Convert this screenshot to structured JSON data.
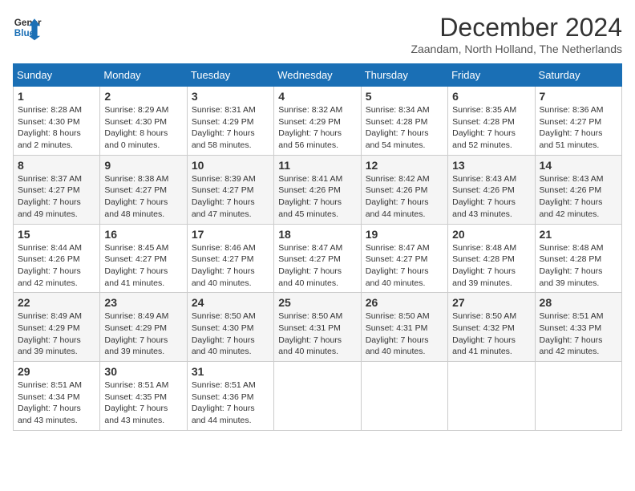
{
  "logo": {
    "line1": "General",
    "line2": "Blue"
  },
  "title": "December 2024",
  "subtitle": "Zaandam, North Holland, The Netherlands",
  "days_of_week": [
    "Sunday",
    "Monday",
    "Tuesday",
    "Wednesday",
    "Thursday",
    "Friday",
    "Saturday"
  ],
  "weeks": [
    [
      {
        "day": "1",
        "sunrise": "8:28 AM",
        "sunset": "4:30 PM",
        "daylight": "8 hours and 2 minutes."
      },
      {
        "day": "2",
        "sunrise": "8:29 AM",
        "sunset": "4:30 PM",
        "daylight": "8 hours and 0 minutes."
      },
      {
        "day": "3",
        "sunrise": "8:31 AM",
        "sunset": "4:29 PM",
        "daylight": "7 hours and 58 minutes."
      },
      {
        "day": "4",
        "sunrise": "8:32 AM",
        "sunset": "4:29 PM",
        "daylight": "7 hours and 56 minutes."
      },
      {
        "day": "5",
        "sunrise": "8:34 AM",
        "sunset": "4:28 PM",
        "daylight": "7 hours and 54 minutes."
      },
      {
        "day": "6",
        "sunrise": "8:35 AM",
        "sunset": "4:28 PM",
        "daylight": "7 hours and 52 minutes."
      },
      {
        "day": "7",
        "sunrise": "8:36 AM",
        "sunset": "4:27 PM",
        "daylight": "7 hours and 51 minutes."
      }
    ],
    [
      {
        "day": "8",
        "sunrise": "8:37 AM",
        "sunset": "4:27 PM",
        "daylight": "7 hours and 49 minutes."
      },
      {
        "day": "9",
        "sunrise": "8:38 AM",
        "sunset": "4:27 PM",
        "daylight": "7 hours and 48 minutes."
      },
      {
        "day": "10",
        "sunrise": "8:39 AM",
        "sunset": "4:27 PM",
        "daylight": "7 hours and 47 minutes."
      },
      {
        "day": "11",
        "sunrise": "8:41 AM",
        "sunset": "4:26 PM",
        "daylight": "7 hours and 45 minutes."
      },
      {
        "day": "12",
        "sunrise": "8:42 AM",
        "sunset": "4:26 PM",
        "daylight": "7 hours and 44 minutes."
      },
      {
        "day": "13",
        "sunrise": "8:43 AM",
        "sunset": "4:26 PM",
        "daylight": "7 hours and 43 minutes."
      },
      {
        "day": "14",
        "sunrise": "8:43 AM",
        "sunset": "4:26 PM",
        "daylight": "7 hours and 42 minutes."
      }
    ],
    [
      {
        "day": "15",
        "sunrise": "8:44 AM",
        "sunset": "4:26 PM",
        "daylight": "7 hours and 42 minutes."
      },
      {
        "day": "16",
        "sunrise": "8:45 AM",
        "sunset": "4:27 PM",
        "daylight": "7 hours and 41 minutes."
      },
      {
        "day": "17",
        "sunrise": "8:46 AM",
        "sunset": "4:27 PM",
        "daylight": "7 hours and 40 minutes."
      },
      {
        "day": "18",
        "sunrise": "8:47 AM",
        "sunset": "4:27 PM",
        "daylight": "7 hours and 40 minutes."
      },
      {
        "day": "19",
        "sunrise": "8:47 AM",
        "sunset": "4:27 PM",
        "daylight": "7 hours and 40 minutes."
      },
      {
        "day": "20",
        "sunrise": "8:48 AM",
        "sunset": "4:28 PM",
        "daylight": "7 hours and 39 minutes."
      },
      {
        "day": "21",
        "sunrise": "8:48 AM",
        "sunset": "4:28 PM",
        "daylight": "7 hours and 39 minutes."
      }
    ],
    [
      {
        "day": "22",
        "sunrise": "8:49 AM",
        "sunset": "4:29 PM",
        "daylight": "7 hours and 39 minutes."
      },
      {
        "day": "23",
        "sunrise": "8:49 AM",
        "sunset": "4:29 PM",
        "daylight": "7 hours and 39 minutes."
      },
      {
        "day": "24",
        "sunrise": "8:50 AM",
        "sunset": "4:30 PM",
        "daylight": "7 hours and 40 minutes."
      },
      {
        "day": "25",
        "sunrise": "8:50 AM",
        "sunset": "4:31 PM",
        "daylight": "7 hours and 40 minutes."
      },
      {
        "day": "26",
        "sunrise": "8:50 AM",
        "sunset": "4:31 PM",
        "daylight": "7 hours and 40 minutes."
      },
      {
        "day": "27",
        "sunrise": "8:50 AM",
        "sunset": "4:32 PM",
        "daylight": "7 hours and 41 minutes."
      },
      {
        "day": "28",
        "sunrise": "8:51 AM",
        "sunset": "4:33 PM",
        "daylight": "7 hours and 42 minutes."
      }
    ],
    [
      {
        "day": "29",
        "sunrise": "8:51 AM",
        "sunset": "4:34 PM",
        "daylight": "7 hours and 43 minutes."
      },
      {
        "day": "30",
        "sunrise": "8:51 AM",
        "sunset": "4:35 PM",
        "daylight": "7 hours and 43 minutes."
      },
      {
        "day": "31",
        "sunrise": "8:51 AM",
        "sunset": "4:36 PM",
        "daylight": "7 hours and 44 minutes."
      },
      null,
      null,
      null,
      null
    ]
  ]
}
